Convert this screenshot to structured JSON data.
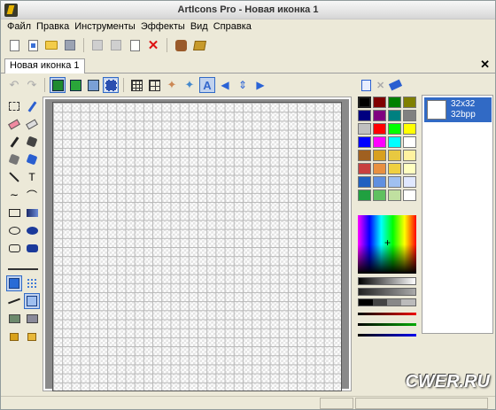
{
  "window": {
    "title": "ArtIcons Pro - Новая иконка 1"
  },
  "menu": {
    "items": [
      "Файл",
      "Правка",
      "Инструменты",
      "Эффекты",
      "Вид",
      "Справка"
    ]
  },
  "toolbar": {
    "icons": [
      "new-icon",
      "new-document-icon",
      "open-folder-icon",
      "save-disk-icon",
      "cut-icon",
      "copy-icon",
      "paste-icon",
      "delete-icon",
      "effects-icon",
      "library-book-icon"
    ]
  },
  "tabs": {
    "document_tab": "Новая иконка 1",
    "close_glyph": "✕"
  },
  "editor_toolbar": {
    "icons": [
      "undo-icon",
      "redo-icon",
      "layer-green-icon",
      "layer-green-2-icon",
      "cube-icon",
      "selection-icon",
      "grid-icon",
      "pixel-grid-icon",
      "magic-icon",
      "magic-2-icon",
      "text-icon",
      "move-left-icon",
      "move-up-down-icon",
      "move-right-icon"
    ]
  },
  "tools": {
    "text_tool_label": "T"
  },
  "color_panel": {
    "colors": [
      "#000000",
      "#800000",
      "#008000",
      "#808000",
      "#000080",
      "#800080",
      "#008080",
      "#808080",
      "#c0c0c0",
      "#ff0000",
      "#00ff00",
      "#ffff00",
      "#0000ff",
      "#ff00ff",
      "#00ffff",
      "#ffffff",
      "#a06020",
      "#d8a020",
      "#e8c840",
      "#fff2a0",
      "#c84040",
      "#e89040",
      "#f0d040",
      "#ffffc0",
      "#2060c0",
      "#6090e0",
      "#a0c0f0",
      "#e0e8ff",
      "#20a040",
      "#60c060",
      "#c0e0a0",
      "#ffffff"
    ],
    "selected_color": "#000000"
  },
  "formats": {
    "items": [
      {
        "size": "32x32",
        "depth": "32bpp"
      }
    ]
  },
  "watermark": "CWER.RU"
}
